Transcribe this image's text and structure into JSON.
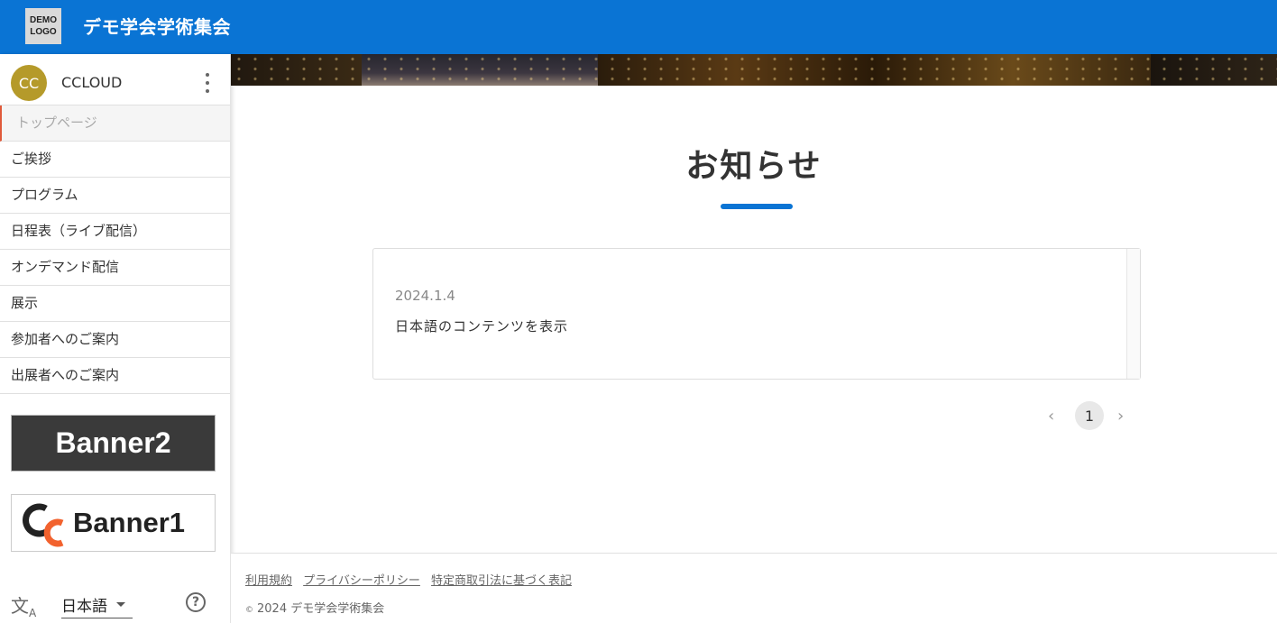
{
  "header": {
    "logo_line1": "DEMO",
    "logo_line2": "LOGO",
    "site_title": "デモ学会学術集会"
  },
  "user": {
    "initials": "CC",
    "name": "CCLOUD"
  },
  "nav": {
    "items": [
      {
        "label": "トップページ"
      },
      {
        "label": "ご挨拶"
      },
      {
        "label": "プログラム"
      },
      {
        "label": "日程表（ライブ配信）"
      },
      {
        "label": "オンデマンド配信"
      },
      {
        "label": "展示"
      },
      {
        "label": "参加者へのご案内"
      },
      {
        "label": "出展者へのご案内"
      }
    ]
  },
  "banners": {
    "banner2": "Banner2",
    "banner1": "Banner1"
  },
  "language": {
    "selected": "日本語"
  },
  "main": {
    "title": "お知らせ",
    "news": [
      {
        "date": "2024.1.4",
        "text": "日本語のコンテンツを表示"
      }
    ],
    "pagination": {
      "current": "1"
    }
  },
  "footer": {
    "links": [
      "利用規約",
      "プライバシーポリシー",
      "特定商取引法に基づく表記"
    ],
    "copyright_symbol": "©",
    "copyright": "2024 デモ学会学術集会"
  },
  "colors": {
    "brand": "#0a74d4",
    "avatar": "#b59a2a",
    "banner_orange": "#f2622e"
  }
}
